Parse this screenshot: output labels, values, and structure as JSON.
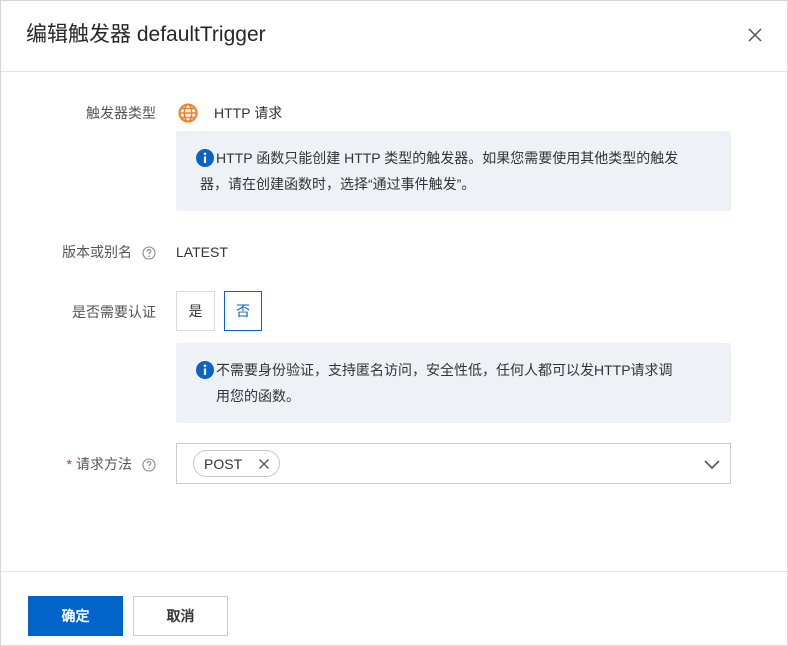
{
  "dialog": {
    "title": "编辑触发器 defaultTrigger"
  },
  "form": {
    "trigger_type": {
      "label": "触发器类型",
      "icon": "globe-icon",
      "value": "HTTP 请求",
      "info_line1": "HTTP 函数只能创建 HTTP 类型的触发器。如果您需要使用其他类型的触发",
      "info_line2": "器，请在创建函数时，选择“通过事件触发”。"
    },
    "version": {
      "label": "版本或别名",
      "value": "LATEST"
    },
    "auth": {
      "label": "是否需要认证",
      "options": [
        "是",
        "否"
      ],
      "selected": "否",
      "info_line1": "不需要身份验证，支持匿名访问，安全性低，任何人都可以发HTTP请求调",
      "info_line2": "用您的函数。"
    },
    "method": {
      "required_mark": "*",
      "label": "请求方法",
      "selected_tags": [
        "POST"
      ]
    }
  },
  "footer": {
    "confirm_label": "确定",
    "cancel_label": "取消"
  },
  "colors": {
    "primary": "#0064c8",
    "info_bg": "#eef1f5",
    "info_icon": "#0b62c7",
    "globe_icon": "#f47e20",
    "required": "#e0292b"
  }
}
